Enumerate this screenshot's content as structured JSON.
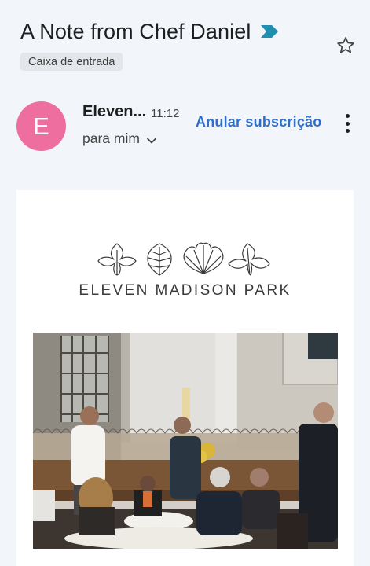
{
  "email": {
    "subject": "A Note from Chef Daniel",
    "label": "Caixa de entrada",
    "avatar_letter": "E",
    "sender": "Eleven...",
    "time": "11:12",
    "recipient": "para mim",
    "unsubscribe": "Anular subscrição"
  },
  "content": {
    "brand_name": "ELEVEN MADISON PARK"
  },
  "colors": {
    "avatar_bg": "#ee6e9f",
    "unsubscribe_link": "#2f6fcb",
    "important_marker": "#1f8fb0",
    "background": "#f2f6fb"
  },
  "icons": [
    "important-marker-icon",
    "star-icon",
    "chevron-down-icon",
    "more-vert-icon"
  ]
}
